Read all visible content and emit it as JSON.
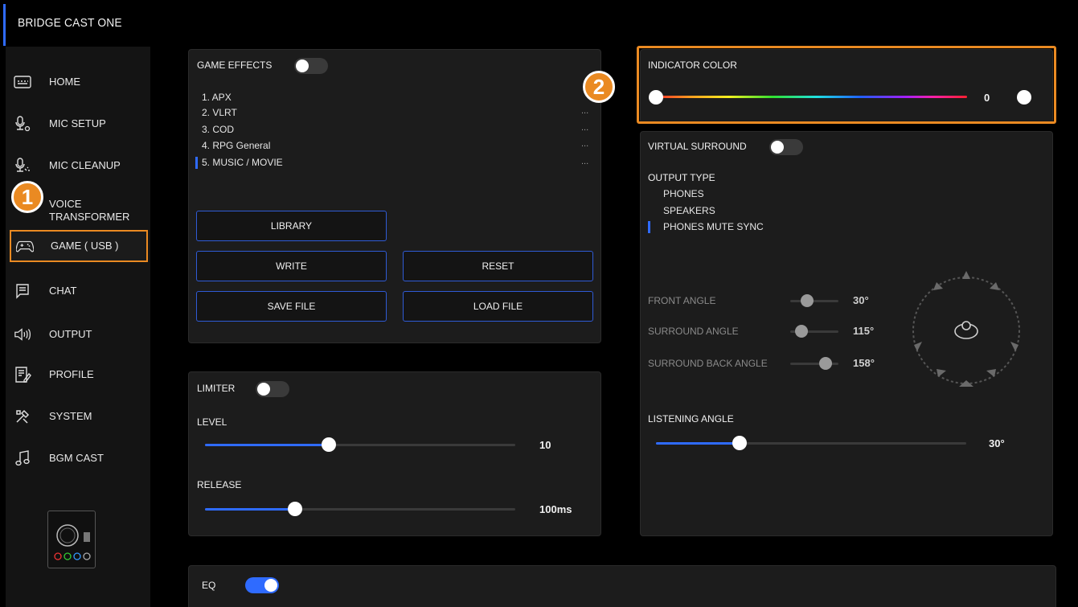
{
  "app": {
    "title": "BRIDGE CAST ONE"
  },
  "sidebar": {
    "items": [
      {
        "label": "HOME",
        "icon": "keyboard-icon"
      },
      {
        "label": "MIC SETUP",
        "icon": "mic-settings-icon"
      },
      {
        "label": "MIC CLEANUP",
        "icon": "mic-cleanup-icon"
      },
      {
        "label": "VOICE\nTRANSFORMER",
        "label_line1": "VOICE",
        "label_line2": "TRANSFORMER",
        "icon": "voice-transformer-icon"
      },
      {
        "label": "GAME ( USB )",
        "icon": "gamepad-icon",
        "active": true
      },
      {
        "label": "CHAT",
        "icon": "chat-icon"
      },
      {
        "label": "OUTPUT",
        "icon": "speaker-icon"
      },
      {
        "label": "PROFILE",
        "icon": "profile-icon"
      },
      {
        "label": "SYSTEM",
        "icon": "tools-icon"
      },
      {
        "label": "BGM CAST",
        "icon": "music-note-icon"
      }
    ]
  },
  "markers": {
    "one": "1",
    "two": "2"
  },
  "game_effects": {
    "title": "GAME EFFECTS",
    "enabled": false,
    "presets": [
      {
        "label": "1. APX",
        "dots": ""
      },
      {
        "label": "2. VLRT",
        "dots": "..."
      },
      {
        "label": "3. COD",
        "dots": "..."
      },
      {
        "label": "4. RPG General",
        "dots": "..."
      },
      {
        "label": "5. MUSIC / MOVIE",
        "dots": "...",
        "selected": true
      }
    ],
    "buttons": {
      "library": "LIBRARY",
      "write": "WRITE",
      "reset": "RESET",
      "save_file": "SAVE FILE",
      "load_file": "LOAD FILE"
    }
  },
  "limiter": {
    "title": "LIMITER",
    "enabled": false,
    "level": {
      "label": "LEVEL",
      "value": "10",
      "fraction": 0.4
    },
    "release": {
      "label": "RELEASE",
      "value": "100ms",
      "fraction": 0.29
    }
  },
  "eq": {
    "title": "EQ",
    "enabled": true
  },
  "indicator_color": {
    "title": "INDICATOR COLOR",
    "value": "0",
    "fraction": 0.0
  },
  "virtual_surround": {
    "title": "VIRTUAL SURROUND",
    "enabled": false,
    "output_type_label": "OUTPUT TYPE",
    "output_types": [
      {
        "label": "PHONES"
      },
      {
        "label": "SPEAKERS"
      },
      {
        "label": "PHONES MUTE SYNC",
        "selected": true
      }
    ],
    "front_angle": {
      "label": "FRONT ANGLE",
      "value": "30°"
    },
    "surround_angle": {
      "label": "SURROUND ANGLE",
      "value": "115°"
    },
    "surround_back_angle": {
      "label": "SURROUND BACK ANGLE",
      "value": "158°"
    },
    "listening_angle": {
      "label": "LISTENING ANGLE",
      "value": "30°",
      "fraction": 0.27
    }
  },
  "colors": {
    "accent": "#2f6bff",
    "highlight": "#ea8a22",
    "panel": "#1c1c1c"
  }
}
